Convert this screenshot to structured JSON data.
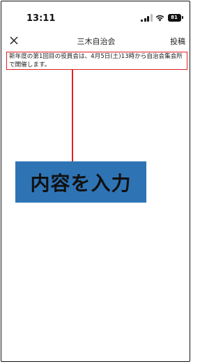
{
  "status_bar": {
    "time": "13:11",
    "battery": "81",
    "icons": [
      "signal-icon",
      "wifi-icon",
      "battery-icon"
    ]
  },
  "nav": {
    "close_icon": "close-icon",
    "title": "三木自治会",
    "post_label": "投稿"
  },
  "editor": {
    "text": "新年度の第1回目の役員会は、4月5日(土)13時から自治会集会所で開催します。"
  },
  "annotation": {
    "callout_text": "内容を入力",
    "highlight_color": "#e02020",
    "callout_color": "#2e74b5"
  }
}
